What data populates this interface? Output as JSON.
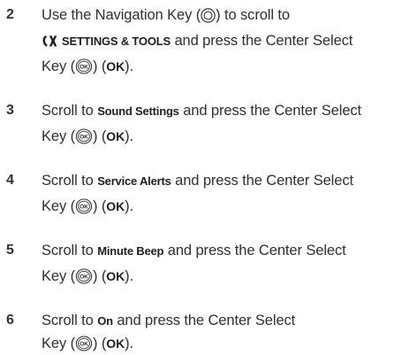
{
  "steps": [
    {
      "number": "2",
      "line1_pre": "Use the Navigation Key (",
      "line1_post": ") to scroll to",
      "menu_label": "SETTINGS & TOOLS",
      "line2_post": "and press the Center Select",
      "line3_pre": "Key (",
      "line3_mid": ") (",
      "ok": "OK",
      "line3_post": ")."
    },
    {
      "number": "3",
      "line1_pre": "Scroll to",
      "item": "Sound Settings",
      "line1_post": "and press the Center Select",
      "line2_pre": "Key (",
      "line2_mid": ") (",
      "ok": "OK",
      "line2_post": ")."
    },
    {
      "number": "4",
      "line1_pre": "Scroll to",
      "item": "Service Alerts",
      "line1_post": "and press the Center Select",
      "line2_pre": "Key (",
      "line2_mid": ") (",
      "ok": "OK",
      "line2_post": ")."
    },
    {
      "number": "5",
      "line1_pre": "Scroll to",
      "item": "Minute Beep",
      "line1_post": "and press the Center Select",
      "line2_pre": "Key (",
      "line2_mid": ") (",
      "ok": "OK",
      "line2_post": ")."
    },
    {
      "number": "6",
      "line1_pre": "Scroll to",
      "item": "On",
      "line1_post": "and press the Center Select",
      "line2_pre": "Key (",
      "line2_mid": ") (",
      "ok": "OK",
      "line2_post": ")."
    }
  ],
  "icons": {
    "navigation_key": "navigation-key-icon",
    "settings_tools": "settings-tools-icon",
    "center_select_key": "ok-key-icon",
    "center_select_key_text": "OK"
  },
  "colors": {
    "text": "#2f2f2f",
    "number": "#333333"
  }
}
